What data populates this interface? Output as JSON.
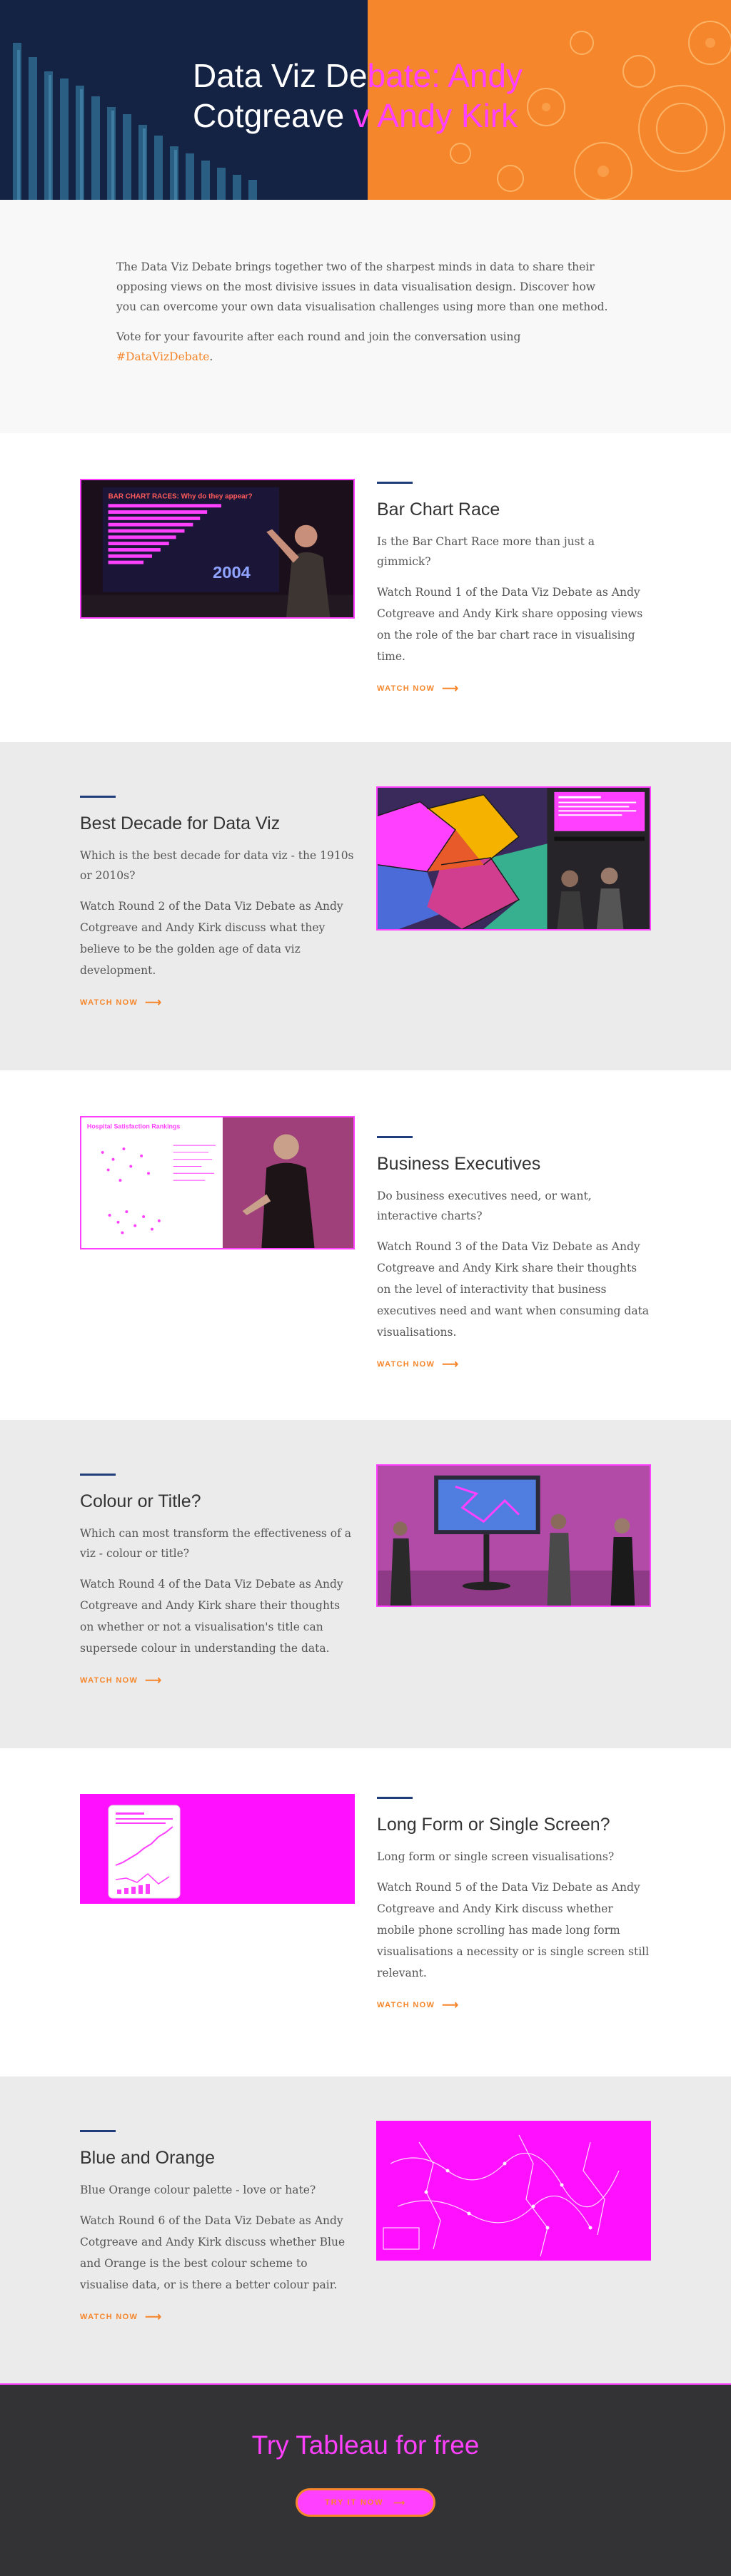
{
  "hero": {
    "title_line1_plain": "Data Viz De",
    "title_line1_hl": "bate: Andy",
    "title_line2_plain": "Cotgreave ",
    "title_line2_hl": "v Andy Kirk"
  },
  "intro": {
    "paragraph1": "The Data Viz Debate brings together two of the sharpest minds in data to share their opposing views on the most divisive issues in data visualisation design. Discover how you can overcome your own data visualisation challenges using more than one method.",
    "paragraph2": "Vote for your favourite after each round and join the conversation using",
    "hashtag": "#DataVizDebate",
    "period": "."
  },
  "rounds": [
    {
      "title": "Bar Chart Race",
      "question": "Is the Bar Chart Race more than just a gimmick?",
      "description": "Watch Round 1 of the Data Viz Debate as Andy Cotgreave and Andy Kirk share opposing views on the role of the bar chart race in visualising time.",
      "watch_label": "WATCH NOW",
      "thumb_title": "BAR CHART RACES: Why do they appear?",
      "thumb_year": "2004"
    },
    {
      "title": "Best Decade for Data Viz",
      "question": "Which is the best decade for data viz - the 1910s or 2010s?",
      "description": "Watch Round 2 of the Data Viz Debate as Andy Cotgreave and Andy Kirk discuss what they believe to be the golden age of data viz development.",
      "watch_label": "WATCH NOW"
    },
    {
      "title": "Business Executives",
      "question": "Do business executives need, or want, interactive charts?",
      "description": "Watch Round 3 of the Data Viz Debate as Andy Cotgreave and Andy Kirk share their thoughts on the level of interactivity that business executives need and want when consuming data visualisations.",
      "watch_label": "WATCH NOW",
      "thumb_title": "Hospital Satisfaction Rankings"
    },
    {
      "title": "Colour or Title?",
      "question": "Which can most transform the effectiveness of a viz - colour or title?",
      "description": "Watch Round 4 of the Data Viz Debate as Andy Cotgreave and Andy Kirk share their thoughts on whether or not a visualisation's title can supersede colour in understanding the data.",
      "watch_label": "WATCH NOW"
    },
    {
      "title": "Long Form or Single Screen?",
      "question": "Long form or single screen visualisations?",
      "description": "Watch Round 5 of the Data Viz Debate as Andy Cotgreave and Andy Kirk discuss whether mobile phone scrolling has made long form visualisations a necessity or is single screen still relevant.",
      "watch_label": "WATCH NOW"
    },
    {
      "title": "Blue and Orange",
      "question": "Blue Orange colour palette - love or hate?",
      "description": "Watch Round 6 of the Data Viz Debate as Andy Cotgreave and Andy Kirk discuss whether Blue and Orange is the best colour scheme to visualise data, or is there a better colour pair.",
      "watch_label": "WATCH NOW"
    }
  ],
  "cta": {
    "heading": "Try Tableau for free",
    "button_label": "TRY IT NOW"
  },
  "colors": {
    "navy": "#142244",
    "orange": "#f5862b",
    "magenta": "#ff40ff",
    "rule_blue": "#1f3d7a",
    "footer": "#333336"
  },
  "icons": [
    "arrow-right-icon"
  ]
}
